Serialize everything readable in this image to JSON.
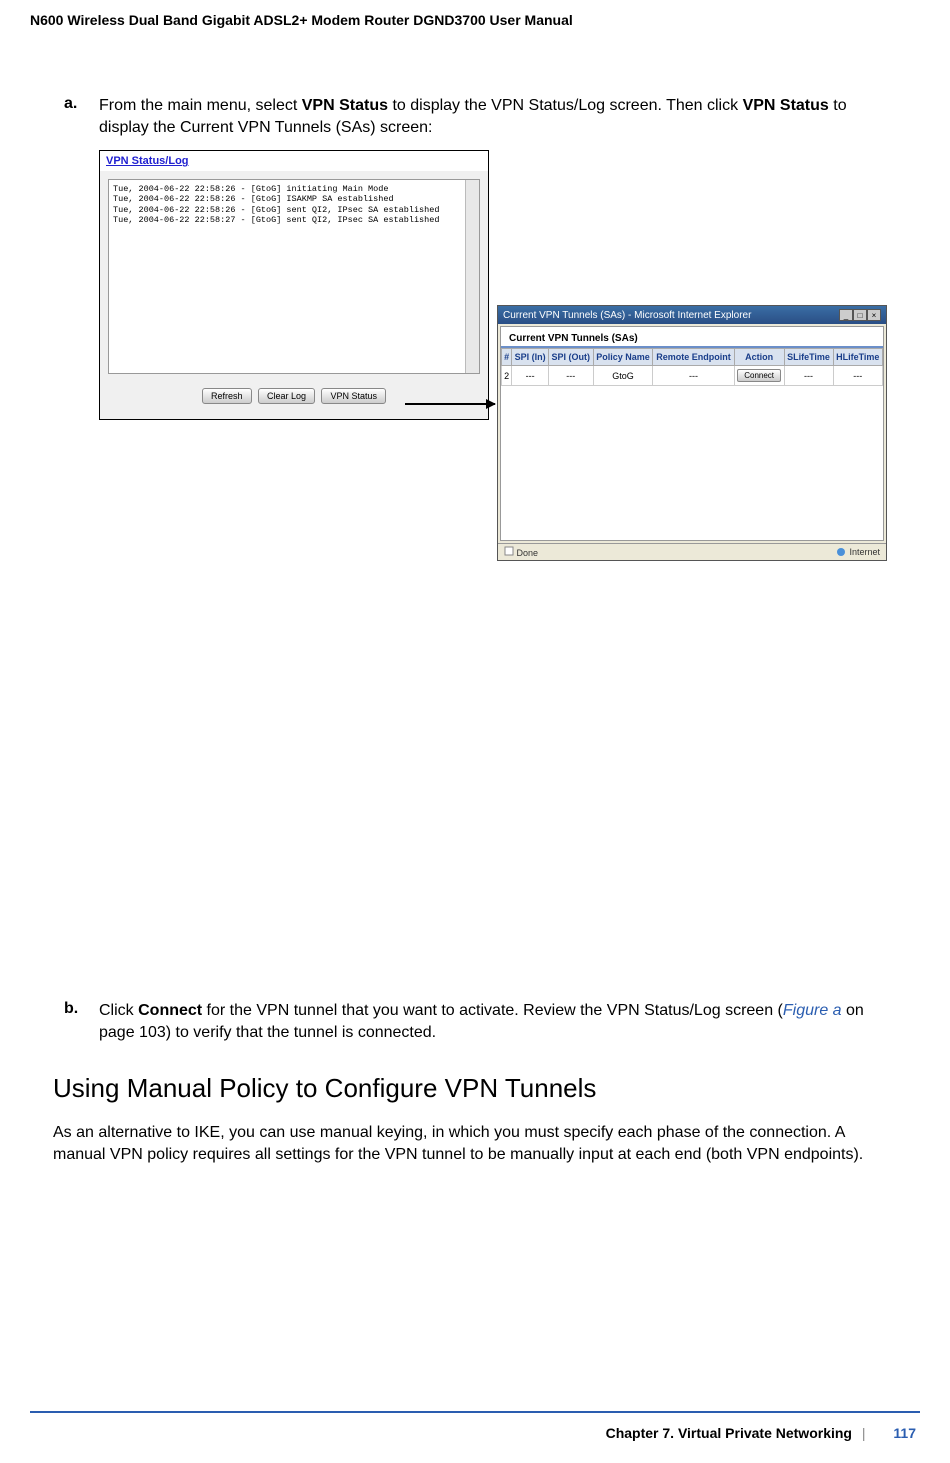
{
  "header": {
    "manual_title": "N600 Wireless Dual Band Gigabit ADSL2+ Modem Router DGND3700 User Manual"
  },
  "steps": {
    "a_marker": "a.",
    "a_text_1": "From the main menu, select ",
    "a_bold_1": "VPN Status",
    "a_text_2": " to display the VPN Status/Log screen. Then click ",
    "a_bold_2": "VPN Status",
    "a_text_3": " to display the Current VPN Tunnels (SAs) screen:",
    "b_marker": "b.",
    "b_text_1": "Click ",
    "b_bold_1": "Connect",
    "b_text_2": " for the VPN tunnel that you want to activate. Review the VPN Status/Log screen (",
    "b_link": "Figure a",
    "b_text_3": " on page 103) to verify that the tunnel is connected."
  },
  "log_window": {
    "title": "VPN Status/Log",
    "lines": [
      "Tue, 2004-06-22 22:58:26 - [GtoG] initiating Main Mode",
      "Tue, 2004-06-22 22:58:26 - [GtoG] ISAKMP SA established",
      "Tue, 2004-06-22 22:58:26 - [GtoG] sent QI2, IPsec SA established",
      "Tue, 2004-06-22 22:58:27 - [GtoG] sent QI2, IPsec SA established"
    ],
    "buttons": {
      "refresh": "Refresh",
      "clear": "Clear Log",
      "vpnstatus": "VPN Status"
    }
  },
  "ie_window": {
    "title": "Current VPN Tunnels (SAs) - Microsoft Internet Explorer",
    "body_title": "Current VPN Tunnels (SAs)",
    "columns": [
      "#",
      "SPI (In)",
      "SPI (Out)",
      "Policy Name",
      "Remote Endpoint",
      "Action",
      "SLifeTime",
      "HLifeTime"
    ],
    "row": {
      "num": "2",
      "spi_in": "---",
      "spi_out": "---",
      "policy": "GtoG",
      "remote": "---",
      "action_label": "Connect",
      "slife": "---",
      "hlife": "---"
    },
    "status_left": "Done",
    "status_right": "Internet"
  },
  "section": {
    "heading": "Using Manual Policy to Configure VPN Tunnels",
    "para": "As an alternative to IKE, you can use manual keying, in which you must specify each phase of the connection. A manual VPN policy requires all settings for the VPN tunnel to be manually input at each end (both VPN endpoints)."
  },
  "footer": {
    "chapter": "Chapter 7.  Virtual Private Networking",
    "page": "117"
  }
}
